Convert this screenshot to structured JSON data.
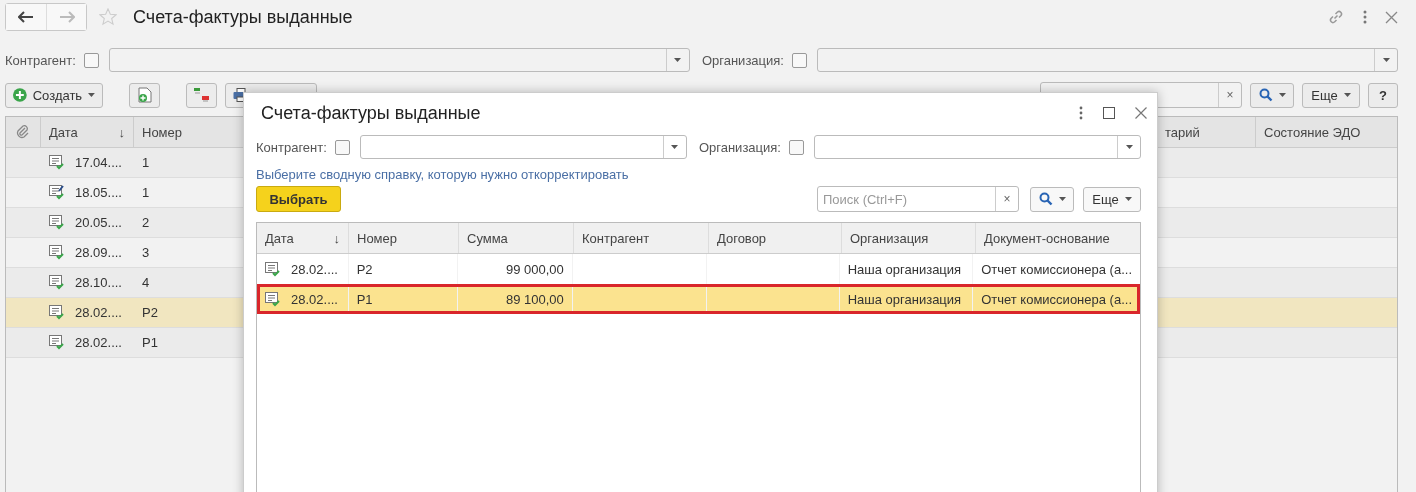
{
  "window": {
    "title": "Счета-фактуры выданные"
  },
  "filters": [
    {
      "label": "Контрагент:",
      "checked": false
    },
    {
      "label": "Организация:",
      "checked": false
    }
  ],
  "toolbar": {
    "create": "Создать",
    "more": "Еще",
    "help": "?",
    "search_clear": "×"
  },
  "table": {
    "columns": [
      {
        "label": "Дата",
        "sort": "↓"
      },
      {
        "label": "Номер"
      },
      {
        "label": "тарий"
      },
      {
        "label": "Состояние ЭДО"
      }
    ],
    "rows": [
      {
        "kind": "posted",
        "date": "17.04....",
        "number": "1",
        "selected": false
      },
      {
        "kind": "edited",
        "date": "18.05....",
        "number": "1",
        "selected": false
      },
      {
        "kind": "posted",
        "date": "20.05....",
        "number": "2",
        "selected": false
      },
      {
        "kind": "posted",
        "date": "28.09....",
        "number": "3",
        "selected": false
      },
      {
        "kind": "posted",
        "date": "28.10....",
        "number": "4",
        "selected": false
      },
      {
        "kind": "posted",
        "date": "28.02....",
        "number": "Р2",
        "selected": true
      },
      {
        "kind": "posted",
        "date": "28.02....",
        "number": "Р1",
        "selected": false
      }
    ]
  },
  "dialog": {
    "title": "Счета-фактуры выданные",
    "filters": [
      {
        "label": "Контрагент:",
        "checked": false
      },
      {
        "label": "Организация:",
        "checked": false
      }
    ],
    "hint": "Выберите сводную справку, которую нужно откорректировать",
    "choose": "Выбрать",
    "search": {
      "placeholder": "Поиск (Ctrl+F)",
      "clear": "×"
    },
    "more": "Еще",
    "columns": [
      {
        "label": "Дата",
        "sort": "↓"
      },
      {
        "label": "Номер"
      },
      {
        "label": "Сумма"
      },
      {
        "label": "Контрагент"
      },
      {
        "label": "Договор"
      },
      {
        "label": "Организация"
      },
      {
        "label": "Документ-основание"
      }
    ],
    "rows": [
      {
        "date": "28.02....",
        "number": "Р2",
        "amount": "99 000,00",
        "organization": "Наша организация",
        "base": "Отчет комиссионера (а...",
        "selected": false
      },
      {
        "date": "28.02....",
        "number": "Р1",
        "amount": "89 100,00",
        "organization": "Наша организация",
        "base": "Отчет комиссионера (а...",
        "selected": true
      }
    ]
  }
}
